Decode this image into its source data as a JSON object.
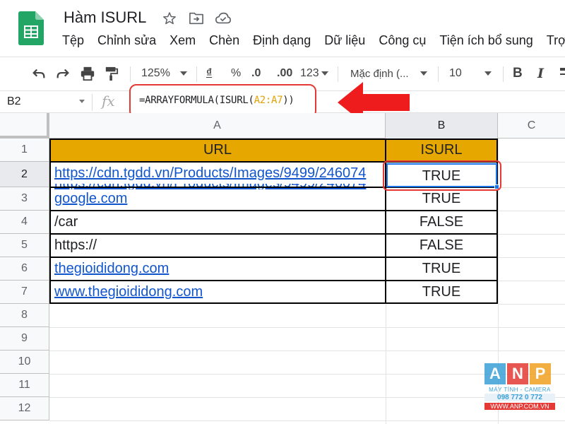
{
  "document": {
    "title": "Hàm ISURL"
  },
  "menu": [
    "Tệp",
    "Chỉnh sửa",
    "Xem",
    "Chèn",
    "Định dạng",
    "Dữ liệu",
    "Công cụ",
    "Tiện ích bổ sung",
    "Trợ giú"
  ],
  "toolbar": {
    "zoom": "125%",
    "currency_symbol": "₫",
    "percent_symbol": "%",
    "decrease_decimal": ".0",
    "increase_decimal": ".00",
    "more_formats": "123",
    "font_family": "Mặc định (...",
    "font_size": "10",
    "bold": "B",
    "italic": "I"
  },
  "formula_bar": {
    "cell_ref": "B2",
    "fx": "fx",
    "formula_prefix": "=ARRAYFORMULA(ISURL(",
    "formula_range": "A2:A7",
    "formula_suffix": "))"
  },
  "grid": {
    "columns": [
      "A",
      "B",
      "C"
    ],
    "rows": [
      "1",
      "2",
      "3",
      "4",
      "5",
      "6",
      "7",
      "8",
      "9",
      "10",
      "11",
      "12"
    ],
    "header_row": {
      "a": "URL",
      "b": "ISURL"
    },
    "data_rows": [
      {
        "a": "https://cdn.tgdd.vn/Products/Images/9499/246074",
        "b": "TRUE",
        "link": true
      },
      {
        "a": "google.com",
        "b": "TRUE",
        "link": true
      },
      {
        "a": "/car",
        "b": "FALSE",
        "link": false
      },
      {
        "a": "https://",
        "b": "FALSE",
        "link": false
      },
      {
        "a": "thegioididong.com",
        "b": "TRUE",
        "link": true
      },
      {
        "a": "www.thegioididong.com",
        "b": "TRUE",
        "link": true
      }
    ],
    "selected_cell": "B2",
    "header_fill": "#e6a800",
    "link_color": "#1155cc"
  },
  "watermark": {
    "letters": [
      "A",
      "N",
      "P"
    ],
    "colors": [
      "#3aa0d8",
      "#e53935",
      "#f0a020"
    ],
    "tagline": "MÁY TÍNH - CAMERA",
    "phone": "098 772 0 772",
    "website": "WWW.ANP.COM.VN"
  },
  "icons": {
    "logo": "sheets-logo-icon",
    "star": "star-icon",
    "move": "move-to-folder-icon",
    "cloud": "cloud-saved-icon",
    "undo": "undo-icon",
    "redo": "redo-icon",
    "print": "print-icon",
    "paint": "paint-format-icon",
    "arrow": "annotation-arrow-icon"
  }
}
